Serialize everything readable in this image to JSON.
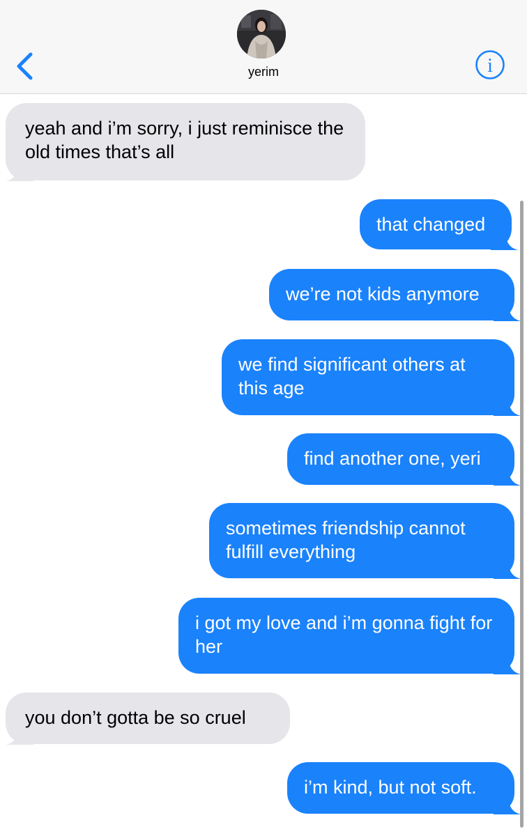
{
  "header": {
    "contact_name": "yerim",
    "back_icon": "chevron-left-icon",
    "info_icon": "info-icon",
    "accent_color": "#1a82fb"
  },
  "messages": [
    {
      "direction": "incoming",
      "text": "yeah and i’m sorry, i just reminisce the old times that’s all"
    },
    {
      "direction": "outgoing",
      "text": "that changed"
    },
    {
      "direction": "outgoing",
      "text": "we’re not kids anymore"
    },
    {
      "direction": "outgoing",
      "text": "we find significant others at this age"
    },
    {
      "direction": "outgoing",
      "text": "find another one, yeri"
    },
    {
      "direction": "outgoing",
      "text": "sometimes friendship cannot fulfill everything"
    },
    {
      "direction": "outgoing",
      "text": "i got my love and i’m gonna fight for her"
    },
    {
      "direction": "incoming",
      "text": "you don’t gotta be so cruel"
    },
    {
      "direction": "outgoing",
      "text": "i’m kind, but not soft."
    }
  ],
  "colors": {
    "incoming_bubble": "#e5e5ea",
    "outgoing_bubble": "#1a82fb",
    "header_bg": "#f7f7f7"
  }
}
